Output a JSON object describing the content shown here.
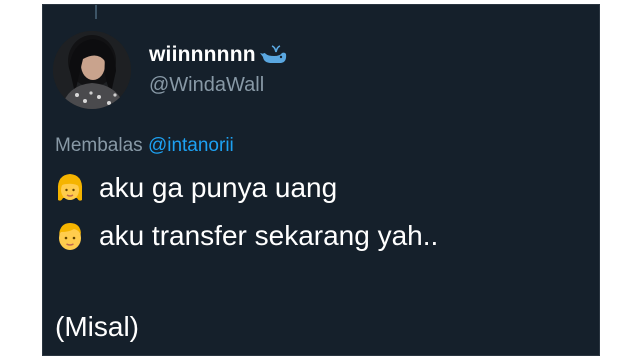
{
  "tweet": {
    "author": {
      "display_name": "wiinnnnnn",
      "badge_icon": "whale-icon",
      "handle": "@WindaWall"
    },
    "reply": {
      "prefix": "Membalas",
      "mention": "@intanorii"
    },
    "lines": [
      {
        "emoji": "woman-emoji",
        "text": "aku ga punya uang"
      },
      {
        "emoji": "man-emoji",
        "text": "aku transfer sekarang yah.."
      },
      {
        "emoji": "",
        "text": ""
      },
      {
        "emoji": "",
        "text": "(Misal)"
      }
    ]
  },
  "colors": {
    "background": "#15202b",
    "text_primary": "#ffffff",
    "text_secondary": "#8899a6",
    "link": "#1da1f2"
  }
}
